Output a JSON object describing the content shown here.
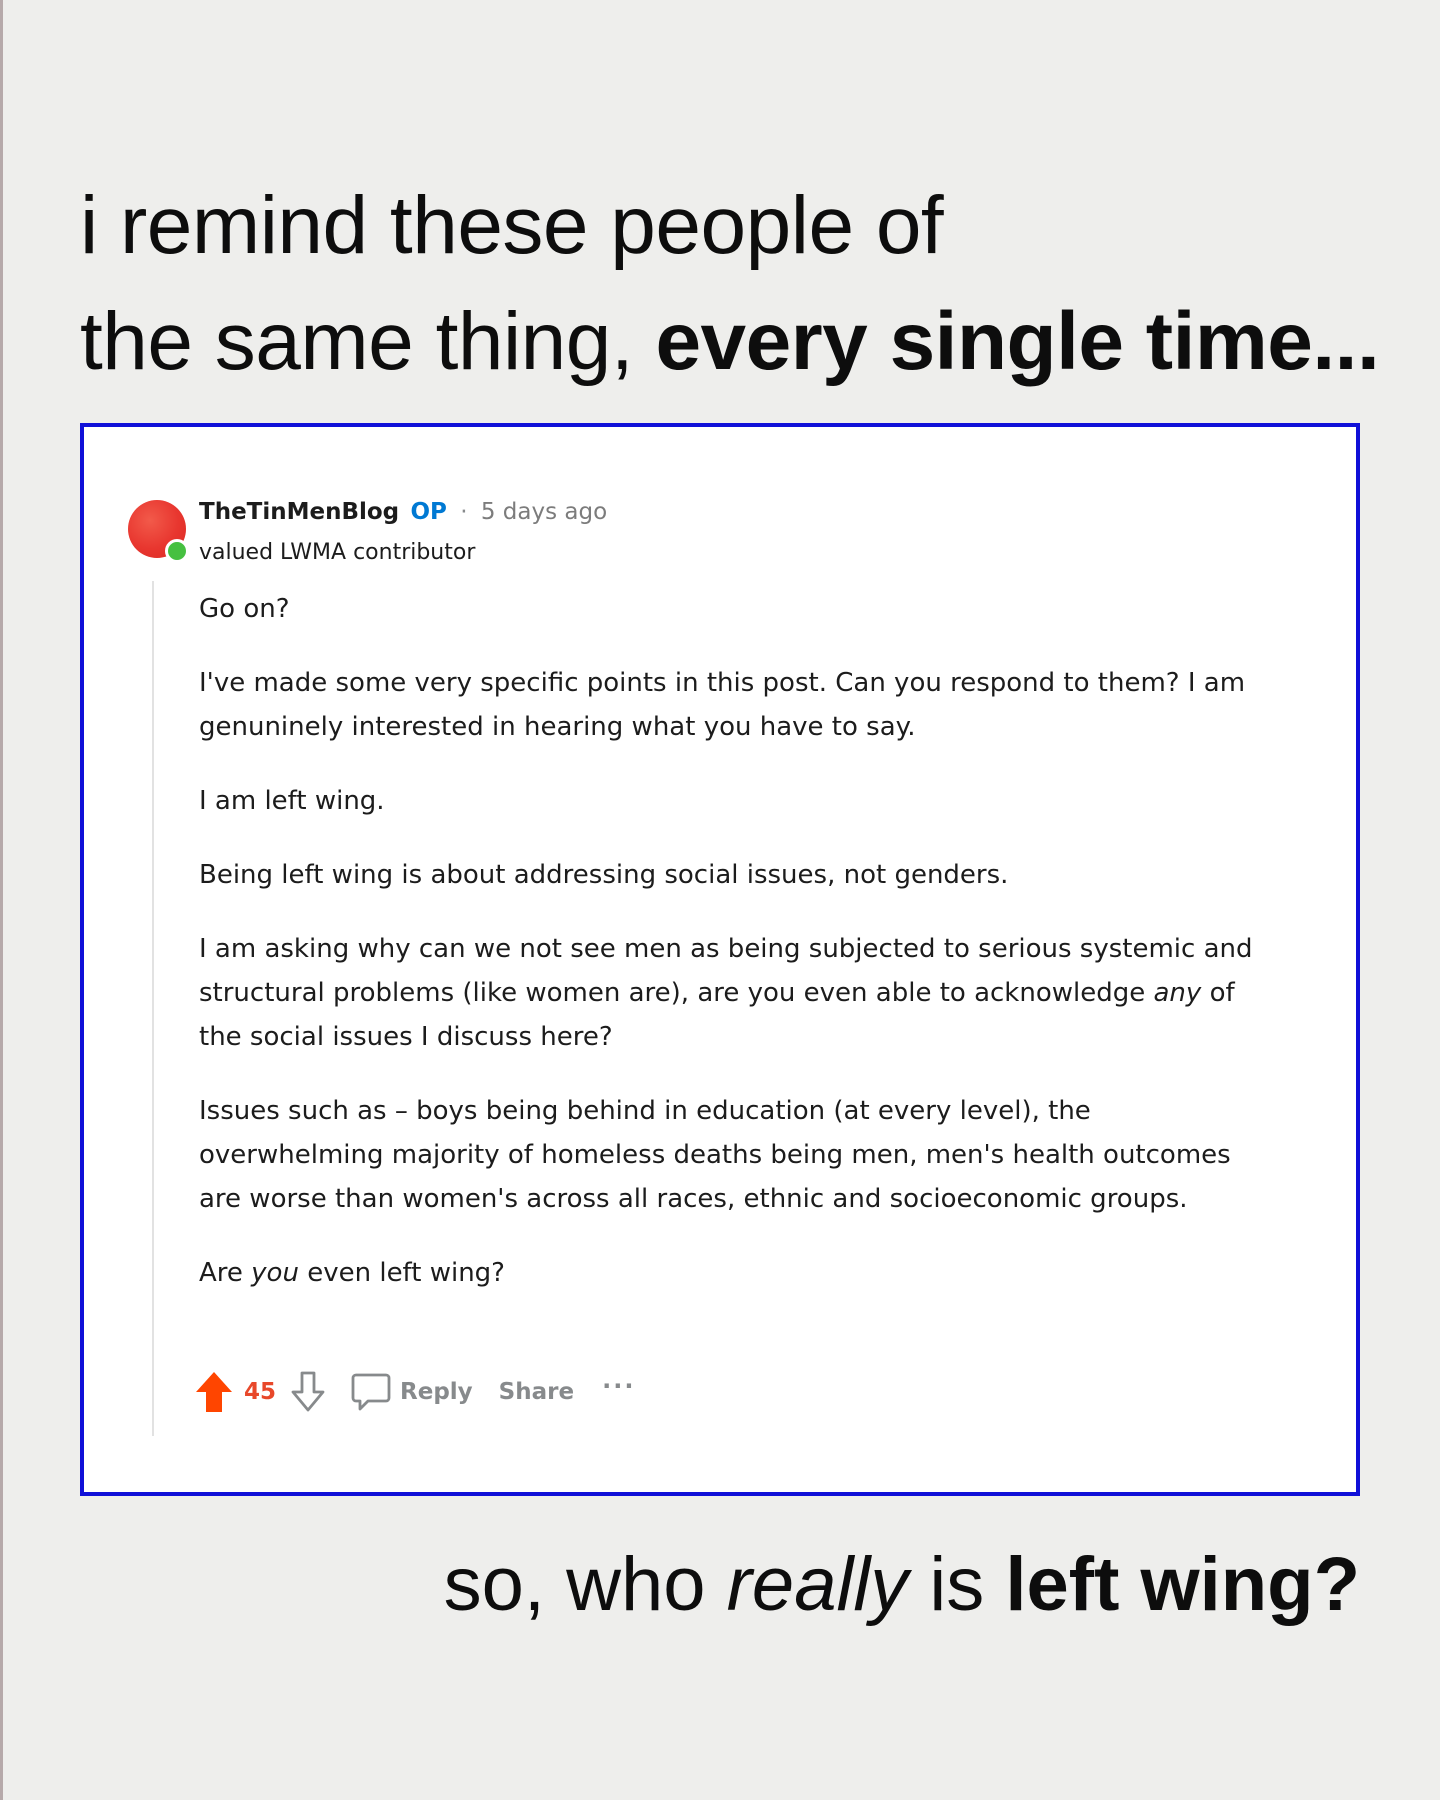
{
  "headline": {
    "line1": "i remind these people of",
    "line2_prefix": "the same thing, ",
    "line2_emphasis": "every single time..."
  },
  "comment": {
    "username": "TheTinMenBlog",
    "op_badge": "OP",
    "separator": "·",
    "timestamp": "5 days ago",
    "flair": "valued LWMA contributor",
    "avatar_icon": "avatar-red-circle",
    "online_status": "online",
    "paragraphs": {
      "p1": "Go on?",
      "p2": "I've made some very specific points in this post. Can you respond to them? I am genuninely interested in hearing what you have to say.",
      "p3": "I am left wing.",
      "p4": "Being left wing is about addressing social issues, not genders.",
      "p5_before": "I am asking why can we not see men as being subjected to serious systemic and structural problems (like women are), are you even able to acknowledge ",
      "p5_italic": "any",
      "p5_after": " of the social issues I discuss here?",
      "p6": "Issues such as – boys being behind in education (at every level), the overwhelming majority of homeless deaths being men, men's health outcomes are worse than women's across all races, ethnic and socioeconomic groups.",
      "p7_before": "Are ",
      "p7_italic": "you",
      "p7_after": " even left wing?"
    },
    "actions": {
      "upvote_icon": "upvote-arrow-icon",
      "score": "45",
      "downvote_icon": "downvote-arrow-icon",
      "comment_icon": "speech-bubble-icon",
      "reply_label": "Reply",
      "share_label": "Share",
      "more_label": "···"
    }
  },
  "footer": {
    "prefix": "so, who ",
    "italic": "really",
    "middle": " is ",
    "bold": "left wing?"
  },
  "colors": {
    "background": "#eeeeec",
    "card_border": "#1010d8",
    "op_blue": "#0079d3",
    "upvote_orange": "#ff4500",
    "online_green": "#46c040",
    "avatar_red": "#e8362f"
  }
}
